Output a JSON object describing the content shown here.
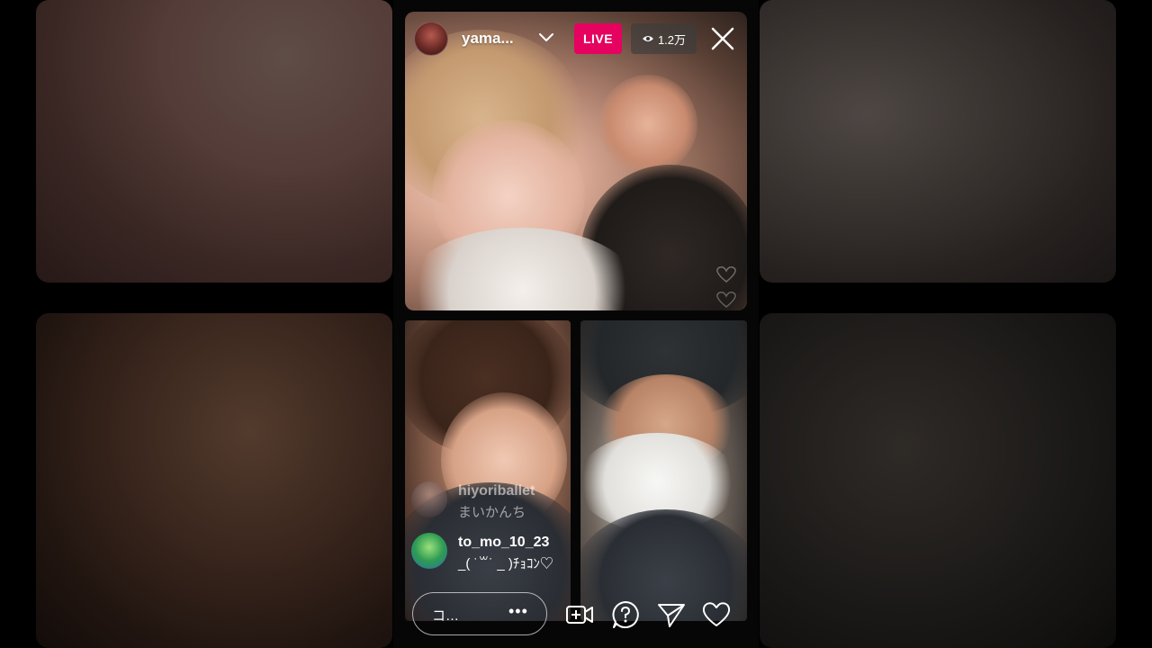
{
  "broadcast": {
    "username": "yama...",
    "live_badge": "LIVE",
    "viewer_count": "1.2万"
  },
  "comments": [
    {
      "username": "hiyoriballet",
      "text": "まいかんち",
      "faded": true
    },
    {
      "username": "to_mo_10_23",
      "text": "_( ˙꒳˙ _ )ﾁｮｺﾝ♡",
      "faded": false
    }
  ],
  "comment_input": {
    "placeholder": "コ…",
    "more_label": "•••"
  },
  "icons": {
    "dropdown": "chevron-down-icon",
    "viewers": "eye-icon",
    "close": "close-icon",
    "add_video": "add-video-icon",
    "question": "question-icon",
    "share": "send-icon",
    "like": "heart-icon"
  },
  "colors": {
    "live_badge": "#e5035f",
    "background": "#000000"
  }
}
